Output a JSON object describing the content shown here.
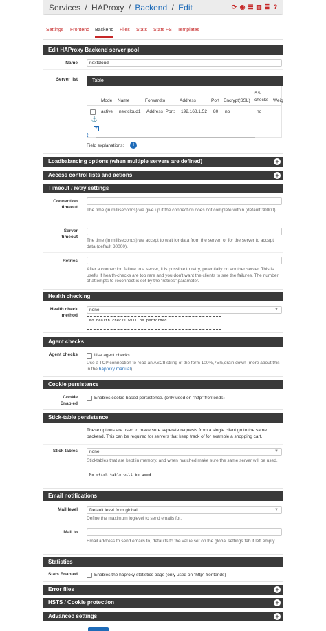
{
  "breadcrumb": {
    "services": "Services",
    "haproxy": "HAProxy",
    "backend": "Backend",
    "edit": "Edit",
    "sep": "/"
  },
  "header_icons": [
    "refresh-icon",
    "stop-icon",
    "sliders-icon",
    "chart-icon",
    "list-icon",
    "help-icon"
  ],
  "tabs": [
    "Settings",
    "Frontend",
    "Backend",
    "Files",
    "Stats",
    "Stats FS",
    "Templates"
  ],
  "active_tab": "Backend",
  "edit_panel": {
    "title": "Edit HAProxy Backend server pool",
    "name_label": "Name",
    "name_value": "nextcloud",
    "serverlist_label": "Server list",
    "table_title": "Table",
    "columns": [
      "Mode",
      "Name",
      "Forwardto",
      "Address",
      "Port",
      "Encrypt(SSL)",
      "SSL checks",
      "Weig"
    ],
    "rows": [
      {
        "mode": "active",
        "name": "nextcloud1",
        "forwardto": "Address+Port:",
        "address": "192.168.1.52",
        "port": "80",
        "encrypt": "no",
        "ssl_checks": "no"
      }
    ],
    "field_explanations": "Field explanations:"
  },
  "collapsed_1": "Loadbalancing options (when multiple servers are defined)",
  "collapsed_2": "Access control lists and actions",
  "timeout": {
    "title": "Timeout / retry settings",
    "connection_label_1": "Connection",
    "connection_label_2": "timeout",
    "connection_help": "The time (in milliseconds) we give up if the connection does not complete within (default 30000).",
    "server_label_1": "Server",
    "server_label_2": "timeout",
    "server_help": "The time (in milliseconds) we accept to wait for data from the server, or for the server to accept data (default 30000).",
    "retries_label": "Retries",
    "retries_help": "After a connection failure to a server, it is possible to retry, potentially on another server. This is useful if health-checks are too rare and you don't want the clients to see the failures. The number of attempts to reconnect is set by the \"retries\" parameter."
  },
  "health": {
    "title": "Health checking",
    "label_1": "Health check",
    "label_2": "method",
    "select_value": "none",
    "textarea": "No health checks will be performed."
  },
  "agent": {
    "title": "Agent checks",
    "label": "Agent checks",
    "checkbox_text": "Use agent checks",
    "help_1": "Use a TCP connection to read an ASCII string of the form 100%,75%,drain,down (more about this in the ",
    "help_link": "haproxy manual",
    "help_2": ")"
  },
  "cookie": {
    "title": "Cookie persistence",
    "label_1": "Cookie",
    "label_2": "Enabled",
    "checkbox_text": "Enables cookie based persistence. (only used on \"http\" frontends)"
  },
  "sticktable": {
    "title": "Stick-table persistence",
    "intro": "These options are used to make sure seperate requests from a single client go to the same backend. This can be required for servers that keep track of for example a shopping cart.",
    "label": "Stick tables",
    "select_value": "none",
    "help": "Sticktables that are kept in memory, and when matched make sure the same server will be used.",
    "textarea": "No stick-table will be used"
  },
  "email": {
    "title": "Email notifications",
    "maillevel_label": "Mail level",
    "maillevel_value": "Default level from global",
    "maillevel_help": "Define the maximum loglevel to send emails for.",
    "mailto_label": "Mail to",
    "mailto_help": "Email address to send emails to, defaults to the value set on the global settings tab if left empty."
  },
  "statistics": {
    "title": "Statistics",
    "label": "Stats Enabled",
    "checkbox_text": "Enables the haproxy statistics page (only used on \"http\" frontends)"
  },
  "collapsed_3": "Error files",
  "collapsed_4": "HSTS / Cookie protection",
  "collapsed_5": "Advanced settings"
}
